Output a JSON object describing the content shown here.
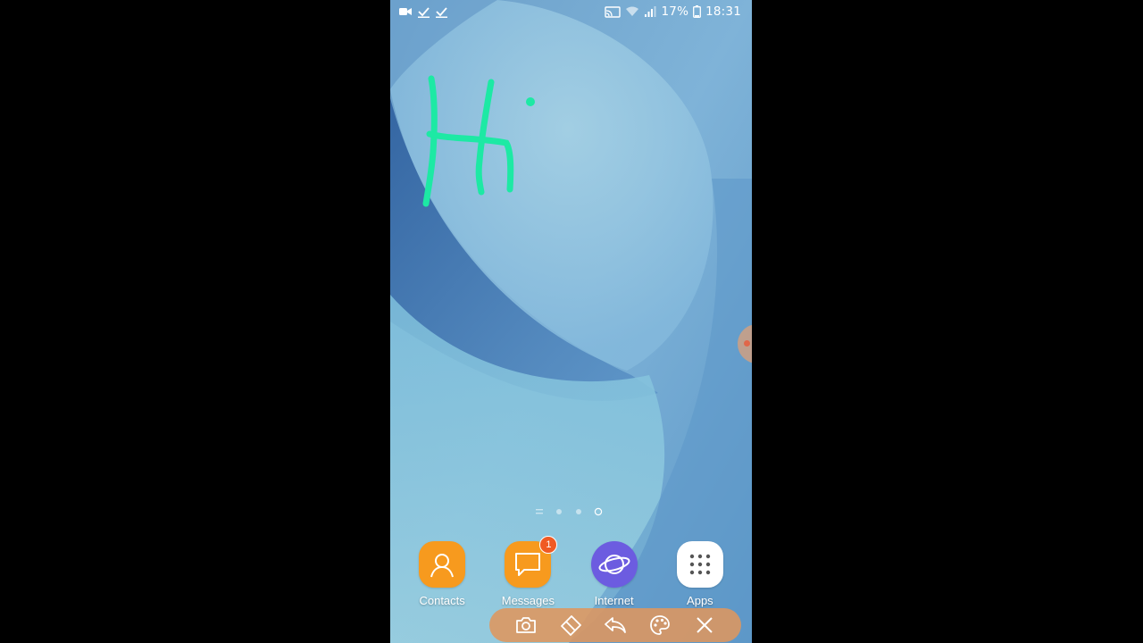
{
  "status_bar": {
    "left_icons": [
      "video-camera-icon",
      "check-icon",
      "check-icon"
    ],
    "right_icons": [
      "cast-icon",
      "wifi-icon",
      "signal-icon",
      "battery-icon"
    ],
    "battery_percent": "17%",
    "time": "18:31"
  },
  "doodle": {
    "text": "Hi",
    "color": "#1de9a4"
  },
  "page_indicator": {
    "pages": 4,
    "current_page": 4
  },
  "dock": {
    "apps": [
      {
        "label": "Contacts",
        "icon": "contacts-icon",
        "color": "#f79a1e"
      },
      {
        "label": "Messages",
        "icon": "messages-icon",
        "color": "#f79a1e",
        "badge": "1"
      },
      {
        "label": "Internet",
        "icon": "internet-icon",
        "color": "#6c5ce0"
      },
      {
        "label": "Apps",
        "icon": "apps-grid-icon",
        "color": "#ffffff"
      }
    ]
  },
  "drawing_toolbar": {
    "tools": [
      "camera-icon",
      "eraser-icon",
      "undo-icon",
      "palette-icon",
      "close-icon"
    ],
    "color": "#de965f"
  },
  "colors": {
    "wallpaper_light": "#8cc3dc",
    "wallpaper_dark": "#3f73b0",
    "badge": "#f05a24"
  }
}
